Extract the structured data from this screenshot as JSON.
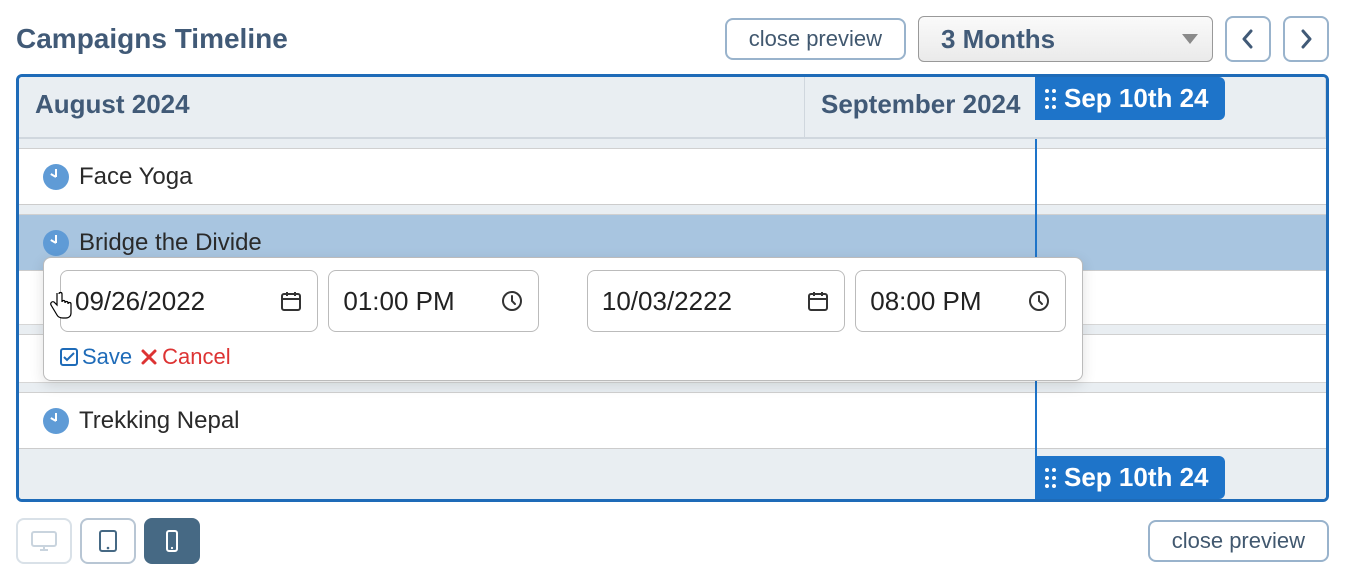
{
  "header": {
    "title": "Campaigns Timeline",
    "close_preview": "close preview",
    "range_label": "3 Months"
  },
  "months": {
    "first": "August 2024",
    "second": "September 2024"
  },
  "marker": {
    "label_top": "Sep 10th 24",
    "label_bottom": "Sep 10th 24"
  },
  "rows": {
    "face_yoga": "Face Yoga",
    "bridge_divide": "Bridge the Divide",
    "trekking_nepal": "Trekking Nepal"
  },
  "popover": {
    "start_date": "09/26/2022",
    "start_time": "01:00 PM",
    "end_date": "10/03/2222",
    "end_time": "08:00 PM",
    "save": "Save",
    "cancel": "Cancel"
  },
  "footer": {
    "close_preview": "close preview"
  }
}
